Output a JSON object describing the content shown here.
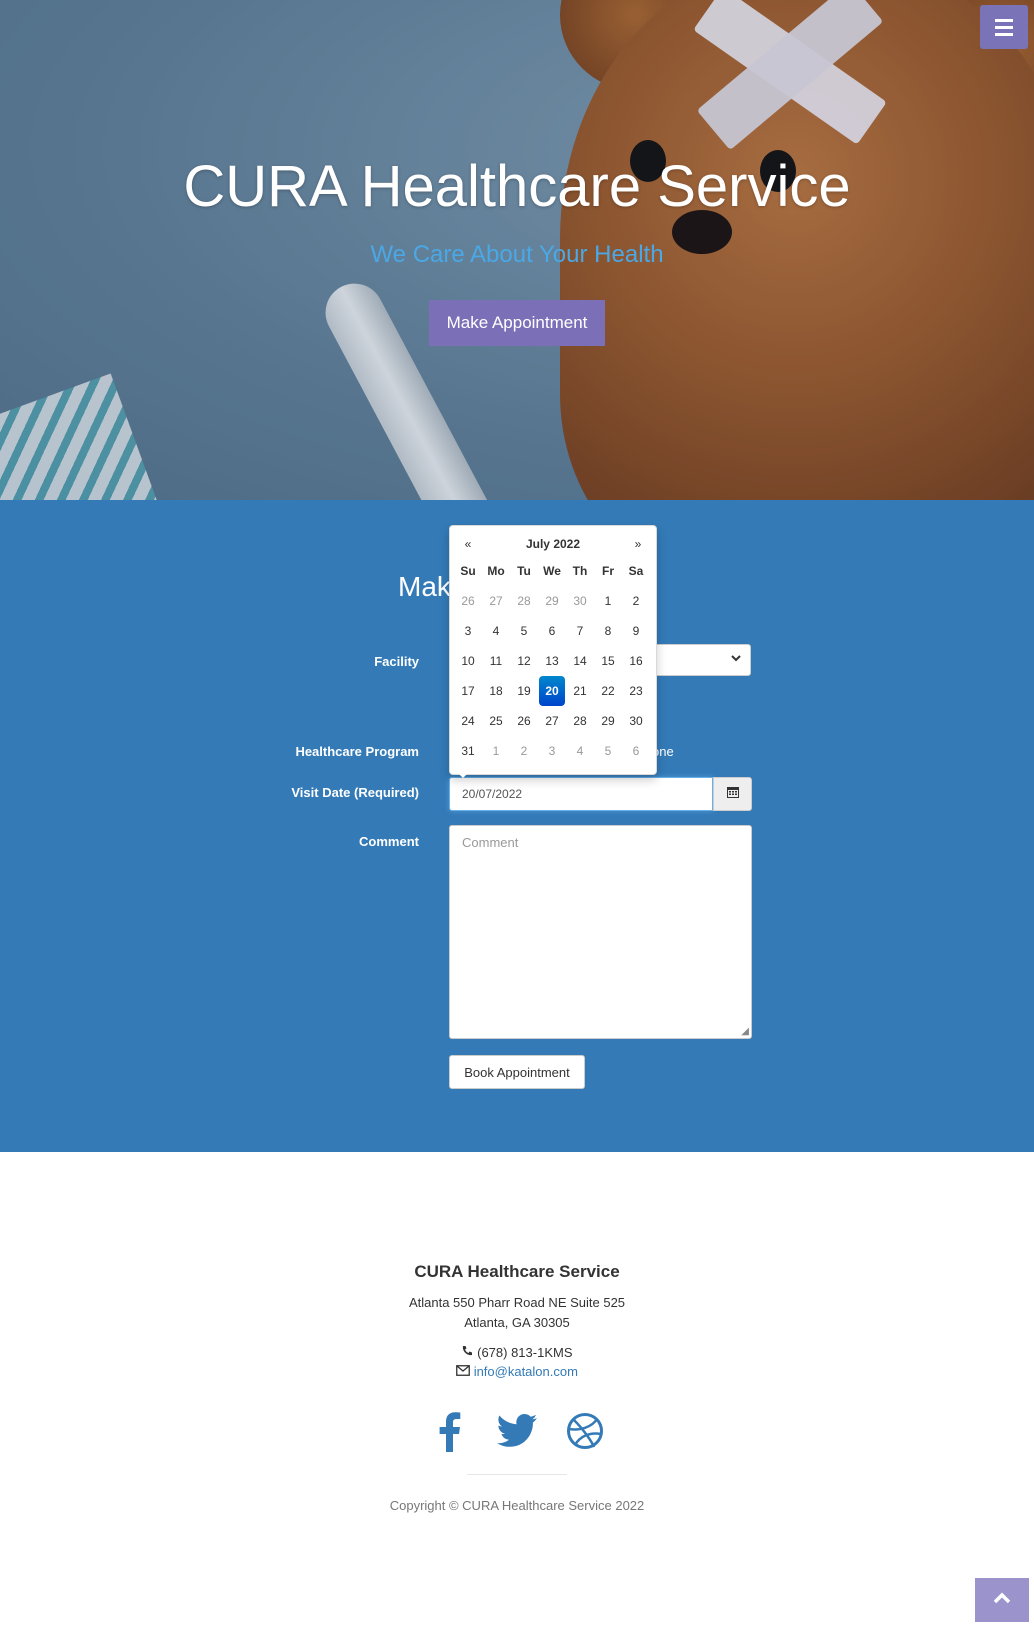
{
  "hero": {
    "title": "CURA Healthcare Service",
    "subtitle": "We Care About Your Health",
    "cta": "Make Appointment"
  },
  "appointment": {
    "heading": "Make Appointment",
    "labels": {
      "facility": "Facility",
      "program": "Healthcare Program",
      "visit_date": "Visit Date (Required)",
      "comment": "Comment"
    },
    "program_option_visible": "one",
    "visit_date_value": "20/07/2022",
    "comment_placeholder": "Comment",
    "book_button": "Book Appointment"
  },
  "datepicker": {
    "prev": "«",
    "next": "»",
    "month": "July 2022",
    "dows": [
      "Su",
      "Mo",
      "Tu",
      "We",
      "Th",
      "Fr",
      "Sa"
    ],
    "weeks": [
      [
        {
          "d": "26",
          "old": true
        },
        {
          "d": "27",
          "old": true
        },
        {
          "d": "28",
          "old": true
        },
        {
          "d": "29",
          "old": true
        },
        {
          "d": "30",
          "old": true
        },
        {
          "d": "1"
        },
        {
          "d": "2"
        }
      ],
      [
        {
          "d": "3"
        },
        {
          "d": "4"
        },
        {
          "d": "5"
        },
        {
          "d": "6"
        },
        {
          "d": "7"
        },
        {
          "d": "8"
        },
        {
          "d": "9"
        }
      ],
      [
        {
          "d": "10"
        },
        {
          "d": "11"
        },
        {
          "d": "12"
        },
        {
          "d": "13"
        },
        {
          "d": "14"
        },
        {
          "d": "15"
        },
        {
          "d": "16"
        }
      ],
      [
        {
          "d": "17"
        },
        {
          "d": "18"
        },
        {
          "d": "19"
        },
        {
          "d": "20",
          "active": true
        },
        {
          "d": "21"
        },
        {
          "d": "22"
        },
        {
          "d": "23"
        }
      ],
      [
        {
          "d": "24"
        },
        {
          "d": "25"
        },
        {
          "d": "26"
        },
        {
          "d": "27"
        },
        {
          "d": "28"
        },
        {
          "d": "29"
        },
        {
          "d": "30"
        }
      ],
      [
        {
          "d": "31"
        },
        {
          "d": "1",
          "old": true
        },
        {
          "d": "2",
          "old": true
        },
        {
          "d": "3",
          "old": true
        },
        {
          "d": "4",
          "old": true
        },
        {
          "d": "5",
          "old": true
        },
        {
          "d": "6",
          "old": true
        }
      ]
    ],
    "selected_color": "#0055cc"
  },
  "footer": {
    "title": "CURA Healthcare Service",
    "address_line1": "Atlanta 550 Pharr Road NE Suite 525",
    "address_line2": "Atlanta, GA 30305",
    "phone": "(678) 813-1KMS",
    "email": "info@katalon.com",
    "socials": [
      "facebook-icon",
      "twitter-icon",
      "dribbble-icon"
    ],
    "copyright": "Copyright © CURA Healthcare Service 2022"
  },
  "colors": {
    "primary": "#337ab7",
    "accent": "#7b6fb8",
    "subtitle": "#4aa8e6"
  }
}
